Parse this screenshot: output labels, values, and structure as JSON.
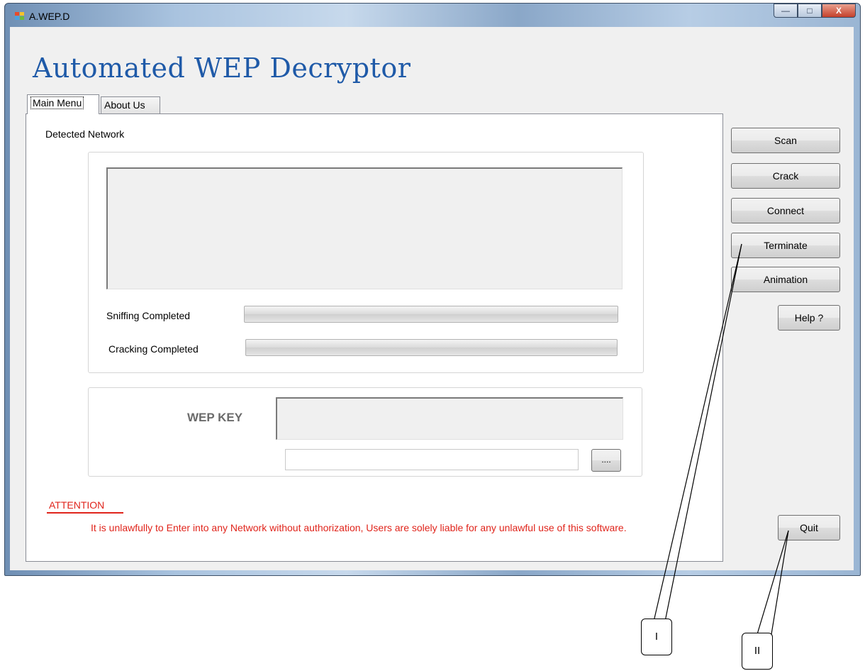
{
  "window": {
    "title": "A.WEP.D",
    "caption_buttons": {
      "minimize": "—",
      "maximize": "□",
      "close": "X"
    }
  },
  "app": {
    "heading": "Automated WEP Decryptor"
  },
  "tabs": [
    {
      "label": "Main Menu",
      "selected": true
    },
    {
      "label": "About Us",
      "selected": false
    }
  ],
  "main": {
    "detected_network_label": "Detected Network",
    "sniffing_label": "Sniffing Completed",
    "sniffing_progress": 0,
    "cracking_label": "Cracking Completed",
    "cracking_progress": 0,
    "wep_key_label": "WEP KEY",
    "key_field_value": "",
    "browse_button": "....",
    "attention_label": "ATTENTION",
    "warning_text": "It is unlawfully to Enter into any Network without authorization, Users are solely liable for any unlawful use of this software."
  },
  "side_buttons": {
    "scan": "Scan",
    "crack": "Crack",
    "connect": "Connect",
    "terminate": "Terminate",
    "animation": "Animation",
    "help": "Help ?",
    "quit": "Quit"
  },
  "callouts": {
    "one": "I",
    "two": "II"
  },
  "colors": {
    "heading": "#1f5aa8",
    "warning": "#e0241b"
  }
}
